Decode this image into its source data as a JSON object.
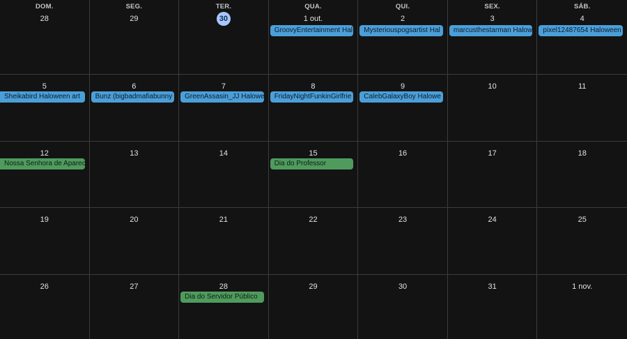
{
  "weekdays": [
    "DOM.",
    "SEG.",
    "TER.",
    "QUA.",
    "QUI.",
    "SEX.",
    "SÁB."
  ],
  "weeks": [
    [
      {
        "day": "28",
        "events": []
      },
      {
        "day": "29",
        "events": []
      },
      {
        "day": "30",
        "today": true,
        "events": []
      },
      {
        "day": "1 out.",
        "events": [
          {
            "title": "GroovyEntertainment Hal",
            "color": "blue"
          }
        ]
      },
      {
        "day": "2",
        "events": [
          {
            "title": "Mysteriouspogsartist Hal",
            "color": "blue"
          }
        ]
      },
      {
        "day": "3",
        "events": [
          {
            "title": "marcusthestarman Halow",
            "color": "blue"
          }
        ]
      },
      {
        "day": "4",
        "events": [
          {
            "title": "pixel12487654 Haloween",
            "color": "blue"
          }
        ]
      }
    ],
    [
      {
        "day": "5",
        "events": [
          {
            "title": "Sheikabird Haloween art",
            "color": "blue"
          }
        ]
      },
      {
        "day": "6",
        "events": [
          {
            "title": "Bunz (bigbadmafiabunny",
            "color": "blue"
          }
        ]
      },
      {
        "day": "7",
        "events": [
          {
            "title": "GreenAssasin_JJ Halowe",
            "color": "blue"
          }
        ]
      },
      {
        "day": "8",
        "events": [
          {
            "title": "FridayNightFunkinGirlfrie",
            "color": "blue"
          }
        ]
      },
      {
        "day": "9",
        "events": [
          {
            "title": "CalebGalaxyBoy Halowe",
            "color": "blue"
          }
        ]
      },
      {
        "day": "10",
        "events": []
      },
      {
        "day": "11",
        "events": []
      }
    ],
    [
      {
        "day": "12",
        "events": [
          {
            "title": "Nossa Senhora de Aparec",
            "color": "green"
          }
        ]
      },
      {
        "day": "13",
        "events": []
      },
      {
        "day": "14",
        "events": []
      },
      {
        "day": "15",
        "events": [
          {
            "title": "Dia do Professor",
            "color": "green"
          }
        ]
      },
      {
        "day": "16",
        "events": []
      },
      {
        "day": "17",
        "events": []
      },
      {
        "day": "18",
        "events": []
      }
    ],
    [
      {
        "day": "19",
        "events": []
      },
      {
        "day": "20",
        "events": []
      },
      {
        "day": "21",
        "events": []
      },
      {
        "day": "22",
        "events": []
      },
      {
        "day": "23",
        "events": []
      },
      {
        "day": "24",
        "events": []
      },
      {
        "day": "25",
        "events": []
      }
    ],
    [
      {
        "day": "26",
        "events": []
      },
      {
        "day": "27",
        "events": []
      },
      {
        "day": "28",
        "events": [
          {
            "title": "Dia do Servidor Público",
            "color": "green"
          }
        ]
      },
      {
        "day": "29",
        "events": []
      },
      {
        "day": "30",
        "events": []
      },
      {
        "day": "31",
        "events": []
      },
      {
        "day": "1 nov.",
        "events": []
      }
    ]
  ],
  "colors": {
    "blue": "#4b9fd9",
    "green": "#4f9b5e",
    "today": "#a8c7fa",
    "background": "#131314",
    "grid": "#3c3c3c"
  }
}
